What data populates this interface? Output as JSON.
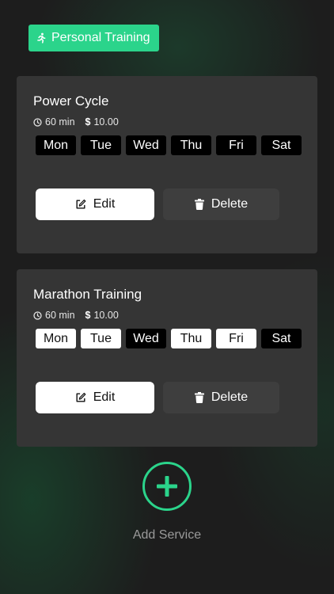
{
  "header": {
    "category_label": "Personal Training",
    "category_icon": "running-person-icon",
    "accent_color": "#2bd48b"
  },
  "services": [
    {
      "title": "Power Cycle",
      "duration": "60 min",
      "price": "10.00",
      "currency_symbol": "$",
      "days": [
        {
          "label": "Mon",
          "selected": false
        },
        {
          "label": "Tue",
          "selected": false
        },
        {
          "label": "Wed",
          "selected": false
        },
        {
          "label": "Thu",
          "selected": false
        },
        {
          "label": "Fri",
          "selected": false
        },
        {
          "label": "Sat",
          "selected": false
        }
      ],
      "edit_label": "Edit",
      "delete_label": "Delete"
    },
    {
      "title": "Marathon Training",
      "duration": "60 min",
      "price": "10.00",
      "currency_symbol": "$",
      "days": [
        {
          "label": "Mon",
          "selected": true
        },
        {
          "label": "Tue",
          "selected": true
        },
        {
          "label": "Wed",
          "selected": false
        },
        {
          "label": "Thu",
          "selected": true
        },
        {
          "label": "Fri",
          "selected": true
        },
        {
          "label": "Sat",
          "selected": false
        }
      ],
      "edit_label": "Edit",
      "delete_label": "Delete"
    }
  ],
  "add_service": {
    "label": "Add Service",
    "icon": "plus-icon"
  }
}
